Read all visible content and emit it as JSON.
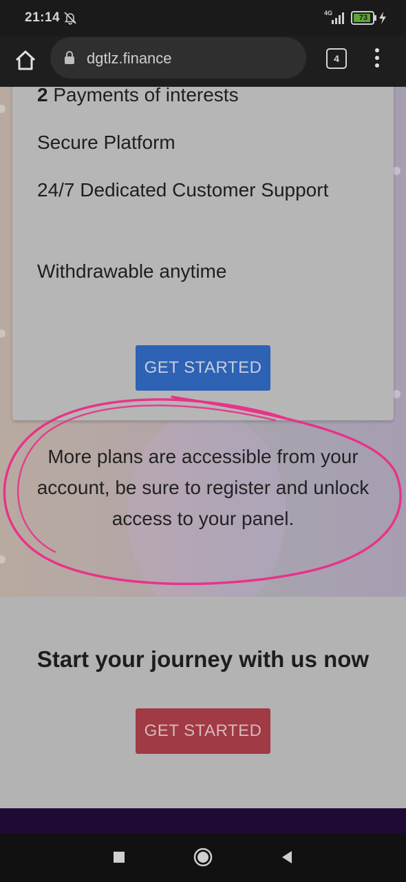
{
  "status": {
    "time": "21:14",
    "network": "4G",
    "battery": "73",
    "icons": [
      "bell-off-icon",
      "signal-icon",
      "battery-icon",
      "charging-bolt-icon"
    ]
  },
  "browser": {
    "url": "dgtlz.finance",
    "tab_count": "4",
    "icons": [
      "home-icon",
      "lock-icon",
      "tabs-icon",
      "overflow-menu-icon"
    ]
  },
  "plan": {
    "features": [
      {
        "strong": "2",
        "text": " Payments of interests"
      },
      {
        "strong": "",
        "text": "Secure Platform"
      },
      {
        "strong": "",
        "text": "24/7 Dedicated Customer Support"
      },
      {
        "strong": "",
        "text": "Withdrawable anytime"
      }
    ],
    "cta_label": "GET STARTED"
  },
  "notice": {
    "text": "More plans are accessible from your account, be sure to register and unlock access to your panel."
  },
  "cta_section": {
    "heading": "Start your journey with us now",
    "button_label": "GET STARTED"
  },
  "colors": {
    "plan_button": "#2d62b5",
    "cta_button": "#a03a44",
    "scribble": "#e8338a",
    "footer": "#1f0a36"
  },
  "nav": {
    "icons": [
      "recents-square-icon",
      "home-circle-icon",
      "back-triangle-icon"
    ]
  }
}
